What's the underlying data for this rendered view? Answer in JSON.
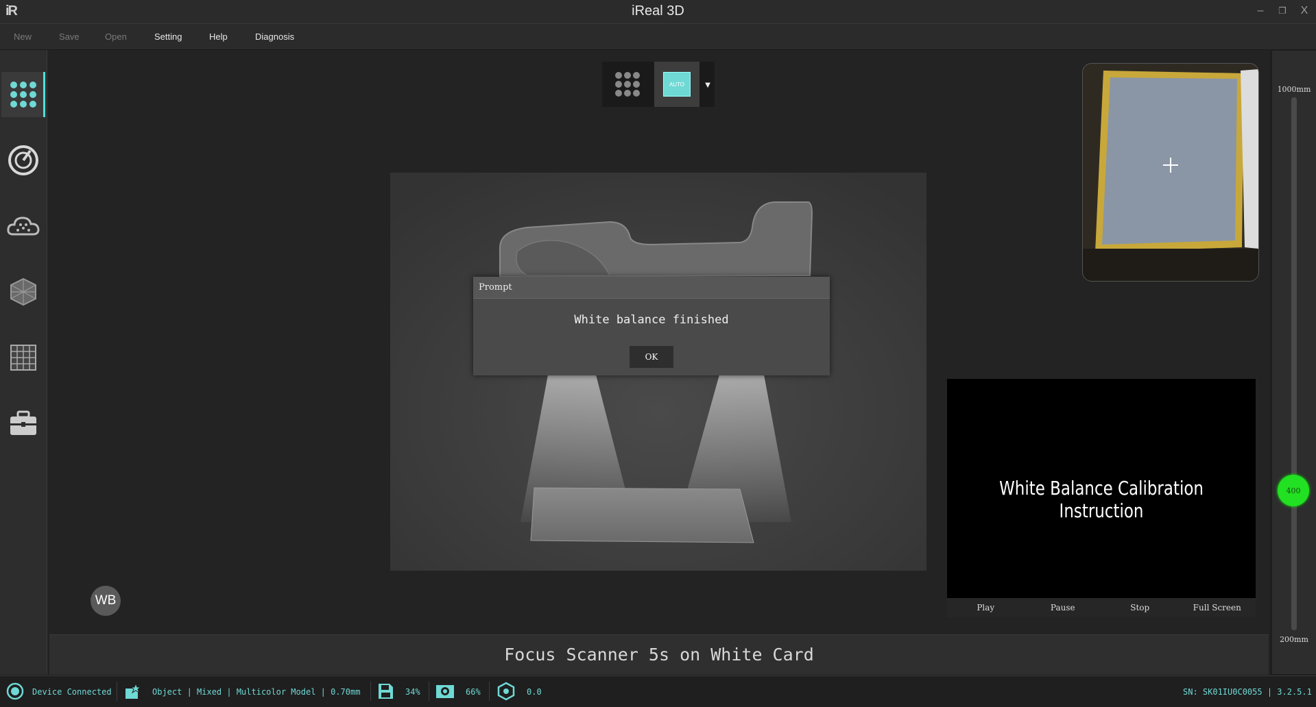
{
  "window": {
    "logo": "iR",
    "title": "iReal 3D",
    "minimize": "–",
    "restore": "❐",
    "close": "X"
  },
  "menu": {
    "new": "New",
    "save": "Save",
    "open": "Open",
    "setting": "Setting",
    "help": "Help",
    "diagnosis": "Diagnosis"
  },
  "sidebar": {
    "items": [
      {
        "name": "scan-mode-icon",
        "active": true
      },
      {
        "name": "scan-target-icon"
      },
      {
        "name": "point-cloud-icon"
      },
      {
        "name": "mesh-icon"
      },
      {
        "name": "grid-icon"
      },
      {
        "name": "toolbox-icon"
      }
    ]
  },
  "toolbar": {
    "auto_label": "AUTO"
  },
  "prompt": {
    "title": "Prompt",
    "message": "White balance finished",
    "ok": "OK"
  },
  "video": {
    "title": "White Balance Calibration Instruction",
    "play": "Play",
    "pause": "Pause",
    "stop": "Stop",
    "fullscreen": "Full Screen"
  },
  "wb_label": "WB",
  "instruction": "Focus Scanner 5s on White Card",
  "distance": {
    "max": "1000mm",
    "min": "200mm",
    "current": "400",
    "current_fraction": 0.25
  },
  "status": {
    "device": "Device Connected",
    "scan_info": "Object | Mixed | Multicolor Model | 0.70mm",
    "storage": "34%",
    "memory": "66%",
    "points": "0.0",
    "serial": "SN: SK01IU0C0055 | 3.2.5.1"
  },
  "colors": {
    "accent": "#6fd9d5",
    "knob": "#22e022"
  }
}
